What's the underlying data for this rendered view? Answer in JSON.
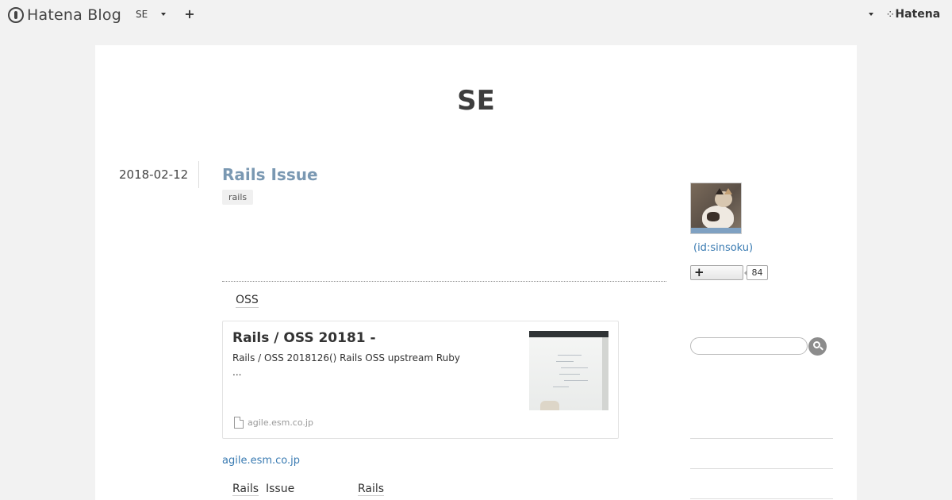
{
  "header": {
    "logo_text": "Hatena Blog",
    "blog_selector": "SE",
    "add_label": "+",
    "brand": "Hatena"
  },
  "blog": {
    "title": "SE"
  },
  "entry": {
    "date": "2018-02-12",
    "title": "Rails  Issue",
    "category": "rails",
    "section_heading": "OSS",
    "embed": {
      "title": "Rails / OSS  20181 -",
      "description": "Rails / OSS 2018126() Rails  OSS  upstream  Ruby ...",
      "site": "agile.esm.co.jp"
    },
    "source_link": "agile.esm.co.jp",
    "related": [
      {
        "part1": "Rails",
        "part2": "Issue"
      },
      {
        "part1": "Rails"
      }
    ]
  },
  "sidebar": {
    "user_id": "(id:sinsoku)",
    "follow_icon": "+",
    "follower_count": "84",
    "search_placeholder": ""
  },
  "colors": {
    "entry_title": "#7a98b2",
    "link": "#3a7bb2",
    "background": "#f2f2f2"
  }
}
